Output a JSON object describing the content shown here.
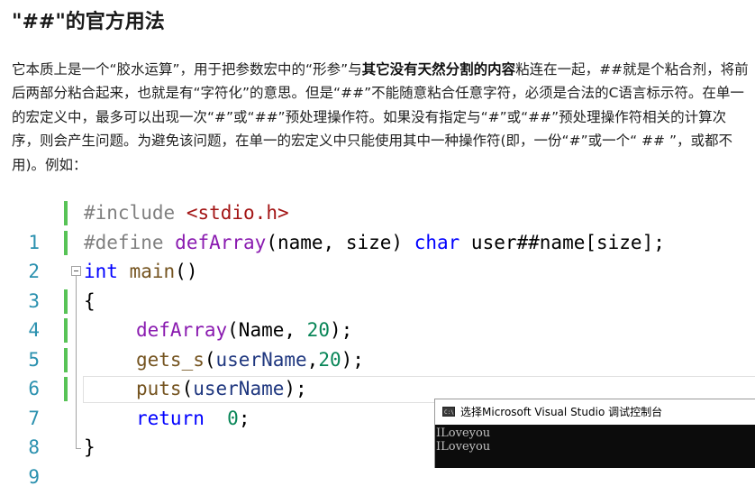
{
  "heading": "\"##\"的官方用法",
  "paragraph": {
    "part1": "它本质上是一个“胶水运算”，用于把参数宏中的“形参”与",
    "bold": "其它没有天然分割的内容",
    "part2": "粘连在一起，##就是个粘合剂，将前后两部分粘合起来，也就是有“字符化”的意思。但是“##”不能随意粘合任意字符，必须是合法的C语言标示符。在单一的宏定义中，最多可以出现一次“#”或“##”预处理操作符。如果没有指定与“#”或“##”预处理操作符相关的计算次序，则会产生问题。为避免该问题，在单一的宏定义中只能使用其中一种操作符(即，一份“#”或一个“ ## ”，或都不用)。例如："
  },
  "code": {
    "line_numbers": [
      "1",
      "2",
      "3",
      "4",
      "5",
      "6",
      "7",
      "8",
      "9"
    ],
    "l1": {
      "directive": "#include",
      "header": "<stdio.h>"
    },
    "l2": {
      "directive": "#define",
      "macro": "defArray",
      "p1": "(name, size) ",
      "kw": "char",
      "p2": " user##name[size];"
    },
    "l3": {
      "kw": "int",
      "fn": "main",
      "p": "()"
    },
    "l4": {
      "brace": "{"
    },
    "l5": {
      "macro": "defArray",
      "p1": "(Name, ",
      "num": "20",
      "p2": ");"
    },
    "l6": {
      "fn": "gets_s",
      "p1": "(",
      "var": "userName",
      "p2": ",",
      "num": "20",
      "p3": ");"
    },
    "l7": {
      "fn": "puts",
      "p1": "(",
      "var": "userName",
      "p2": ");"
    },
    "l8": {
      "kw": "return",
      "p1": "  ",
      "num": "0",
      "p2": ";"
    },
    "l9": {
      "brace": "}"
    }
  },
  "console": {
    "title": "选择Microsoft Visual Studio 调试控制台",
    "lines": [
      "ILoveyou",
      "ILoveyou"
    ]
  },
  "icons": {
    "console": "console-window-icon",
    "fold": "collapse-minus-icon"
  },
  "colors": {
    "keyword": "#0000ff",
    "macro": "#8a1bb0",
    "function": "#74531f",
    "variable": "#1f377f",
    "number": "#098658",
    "string": "#a31515",
    "preprocessor": "#808080",
    "line_number": "#2b91af",
    "change_bar": "#57c356"
  }
}
